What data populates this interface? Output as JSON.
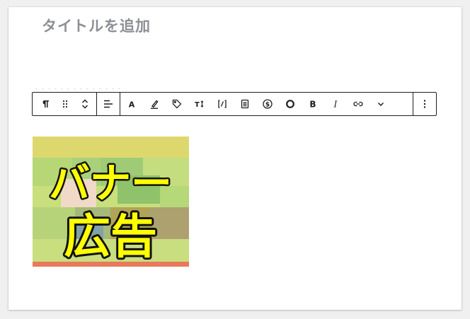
{
  "editor": {
    "post_title": "タイトルを追加",
    "faint_text": "・・・・・・・・・・・・・・"
  },
  "toolbar": {
    "groups": [
      [
        {
          "name": "paragraph-block-icon",
          "glyph": "¶"
        },
        {
          "name": "drag-handle-icon",
          "glyph": "⠿"
        },
        {
          "name": "move-up-down-icon",
          "glyph": "⌃⌄"
        }
      ],
      [
        {
          "name": "align-icon",
          "glyph": "align"
        }
      ],
      [
        {
          "name": "text-color-icon",
          "glyph": "A"
        },
        {
          "name": "highlight-icon",
          "glyph": "highlight"
        },
        {
          "name": "tag-icon",
          "glyph": "tag"
        },
        {
          "name": "font-size-icon",
          "glyph": "T↕"
        },
        {
          "name": "shortcode-icon",
          "glyph": "[/]"
        },
        {
          "name": "document-icon",
          "glyph": "doc"
        },
        {
          "name": "dollar-icon",
          "glyph": "$"
        },
        {
          "name": "circle-icon",
          "glyph": "circle"
        },
        {
          "name": "bold-icon",
          "glyph": "B"
        },
        {
          "name": "italic-icon",
          "glyph": "I"
        },
        {
          "name": "link-icon",
          "glyph": "link"
        },
        {
          "name": "chevron-down-icon",
          "glyph": "⌄"
        }
      ],
      [
        {
          "name": "more-options-icon",
          "glyph": "⋮"
        }
      ]
    ]
  },
  "banner": {
    "line1": "バナー",
    "line2": "広告",
    "text_color": "#ffff00",
    "outline_color": "#111111",
    "bottom_stripe_color": "#e8795a"
  }
}
